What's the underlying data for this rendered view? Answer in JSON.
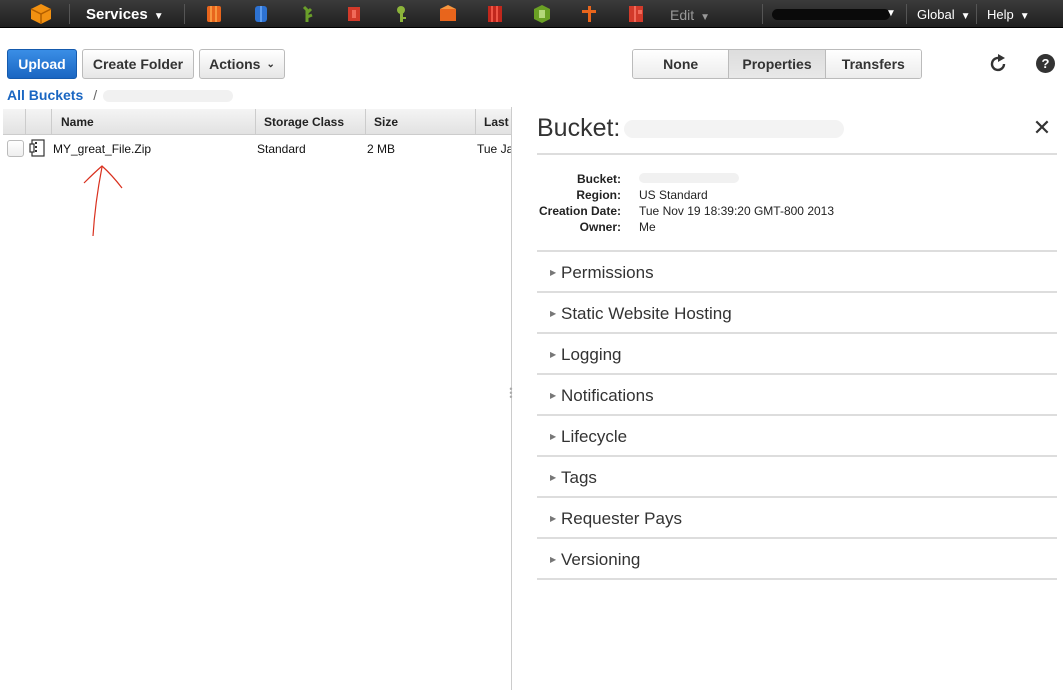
{
  "nav": {
    "services_label": "Services",
    "edit_label": "Edit",
    "region_label": "Global",
    "help_label": "Help",
    "service_icons": [
      "ec2-icon",
      "dynamodb-icon",
      "elastic-beanstalk-icon",
      "cloudformation-icon",
      "iam-icon",
      "cloudfront-icon",
      "s3-icon",
      "vpc-icon",
      "cloudwatch-icon",
      "glacier-icon"
    ]
  },
  "toolbar": {
    "upload": "Upload",
    "create_folder": "Create Folder",
    "actions": "Actions",
    "view_tabs": [
      "None",
      "Properties",
      "Transfers"
    ],
    "active_tab": "Properties"
  },
  "breadcrumb": {
    "root": "All Buckets",
    "separator": "/"
  },
  "table": {
    "columns": [
      "Name",
      "Storage Class",
      "Size",
      "Last"
    ],
    "rows": [
      {
        "name": "MY_great_File.Zip",
        "storage_class": "Standard",
        "size": "2 MB",
        "last_modified": "Tue Ja"
      }
    ]
  },
  "panel": {
    "title": "Bucket:",
    "details": [
      {
        "key": "Bucket:",
        "value": ""
      },
      {
        "key": "Region:",
        "value": "US Standard"
      },
      {
        "key": "Creation Date:",
        "value": "Tue Nov 19 18:39:20 GMT-800 2013"
      },
      {
        "key": "Owner:",
        "value": "Me"
      }
    ],
    "sections": [
      "Permissions",
      "Static Website Hosting",
      "Logging",
      "Notifications",
      "Lifecycle",
      "Tags",
      "Requester Pays",
      "Versioning"
    ]
  },
  "colors": {
    "nav_bg": "#2b2b2b",
    "upload_blue": "#1a66c2",
    "link_blue": "#1a66c2",
    "annotation_red": "#d9301e"
  }
}
